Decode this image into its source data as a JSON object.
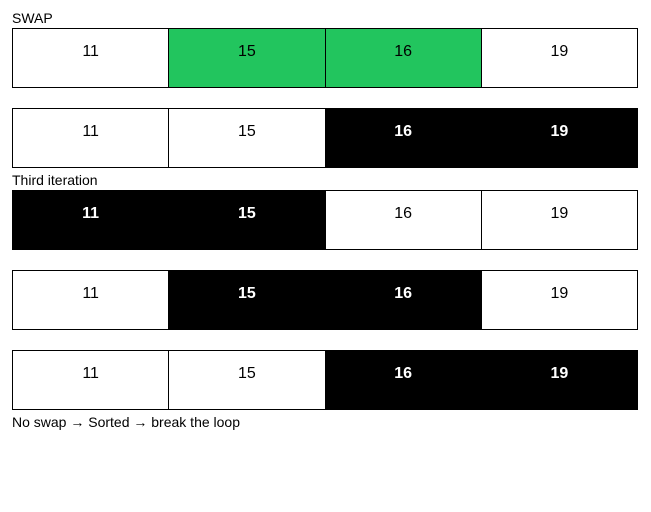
{
  "labels": {
    "swap": "SWAP",
    "third_iteration": "Third iteration",
    "no_swap": "No swap → Sorted → break the loop"
  },
  "rows": [
    {
      "cells": [
        {
          "value": "11",
          "style": "white"
        },
        {
          "value": "15",
          "style": "green"
        },
        {
          "value": "16",
          "style": "green"
        },
        {
          "value": "19",
          "style": "white"
        }
      ]
    },
    {
      "cells": [
        {
          "value": "11",
          "style": "white"
        },
        {
          "value": "15",
          "style": "white"
        },
        {
          "value": "16",
          "style": "black"
        },
        {
          "value": "19",
          "style": "black"
        }
      ]
    },
    {
      "cells": [
        {
          "value": "11",
          "style": "black"
        },
        {
          "value": "15",
          "style": "black"
        },
        {
          "value": "16",
          "style": "white"
        },
        {
          "value": "19",
          "style": "white"
        }
      ]
    },
    {
      "cells": [
        {
          "value": "11",
          "style": "white"
        },
        {
          "value": "15",
          "style": "black"
        },
        {
          "value": "16",
          "style": "black"
        },
        {
          "value": "19",
          "style": "white"
        }
      ]
    },
    {
      "cells": [
        {
          "value": "11",
          "style": "white"
        },
        {
          "value": "15",
          "style": "white"
        },
        {
          "value": "16",
          "style": "black"
        },
        {
          "value": "19",
          "style": "black"
        }
      ]
    }
  ]
}
